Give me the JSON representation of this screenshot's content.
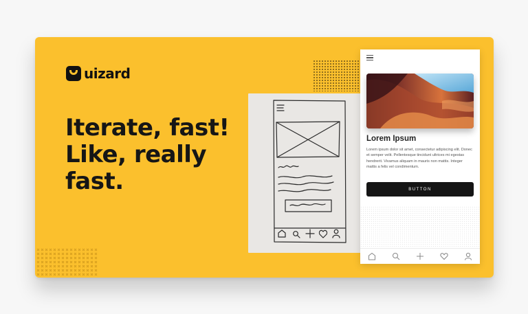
{
  "brand": {
    "name": "uizard"
  },
  "headline": {
    "lines": [
      "Iterate, fast!",
      "Like, really",
      "fast."
    ]
  },
  "colors": {
    "background": "#fbc02d",
    "text": "#161616",
    "button": "#151515"
  },
  "mockup": {
    "card_title": "Lorem Ipsum",
    "card_body": "Lorem ipsum dolor sit amet, consectetur adipiscing elit. Donec et semper velit. Pellentesque tincidunt ultrices mi egestas hendrerit. Vivamus aliquam in mauris non mattis. Integer mattis a felis vel condimentum.",
    "button_label": "BUTTON",
    "nav_icons": [
      "home-icon",
      "search-icon",
      "plus-icon",
      "heart-icon",
      "user-icon"
    ]
  },
  "sketch": {
    "nav_icons": [
      "home-icon",
      "search-icon",
      "plus-icon",
      "heart-icon",
      "user-icon"
    ]
  }
}
